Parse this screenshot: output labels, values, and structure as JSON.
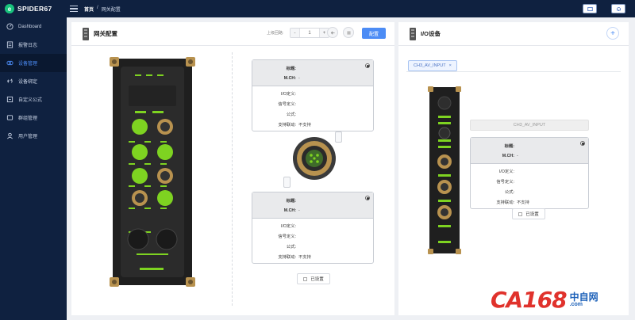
{
  "brand": {
    "name": "SPIDER67"
  },
  "nav": [
    {
      "label": "Dashboard",
      "icon": "gauge-icon"
    },
    {
      "label": "报警日志",
      "icon": "log-icon"
    },
    {
      "label": "设备管理",
      "icon": "device-icon",
      "active": true
    },
    {
      "label": "设备绑定",
      "icon": "link-icon"
    },
    {
      "label": "自定义公式",
      "icon": "formula-icon"
    },
    {
      "label": "群组管理",
      "icon": "group-icon"
    },
    {
      "label": "用户管理",
      "icon": "user-icon"
    }
  ],
  "breadcrumb": {
    "home": "首页",
    "sep": "/",
    "current": "网关配置"
  },
  "left_panel": {
    "title": "网关配置",
    "ctrl_label": "上级回路:",
    "stepper": {
      "minus": "-",
      "value": "1",
      "plus": "+"
    },
    "primary_button": "配置",
    "set_button": "已设置"
  },
  "info_card": {
    "title_label": "标题:",
    "mch_label": "M.CH:",
    "mch_value": "-",
    "io_label": "I/O定义:",
    "signal_label": "信号定义:",
    "formula_label": "公式:",
    "linkage_label": "支持联动:",
    "linkage_value": "不支持"
  },
  "right_panel": {
    "title": "I/O设备",
    "add_label": "+",
    "tab_label": "CH3_AV_INPUT",
    "tab_close": "×",
    "name_value": "CH3_AV_INPUT",
    "set_button": "已设置"
  },
  "watermark": {
    "big": "CA168",
    "cn": "中自网",
    "url": ".com"
  },
  "colors": {
    "sidebar": "#0f2140",
    "accent": "#4c8cf5",
    "led_green": "#7ed321",
    "metal": "#b8924f"
  }
}
